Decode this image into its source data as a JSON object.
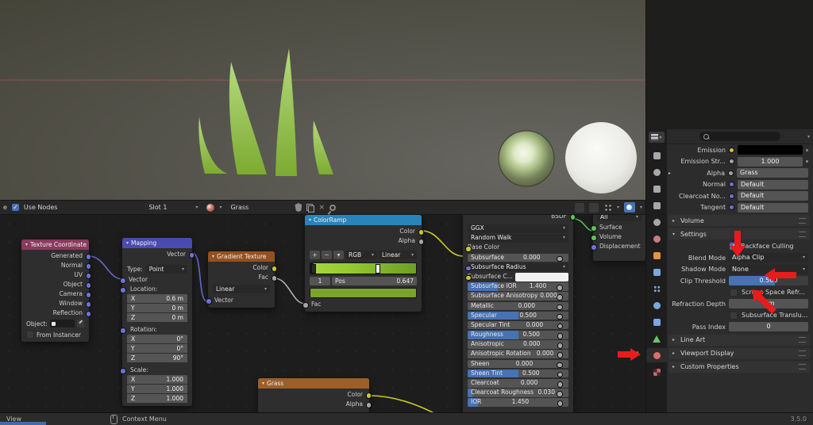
{
  "meta": {
    "version": "3.5.0"
  },
  "shader_header": {
    "left_fragment": "e",
    "use_nodes_label": "Use Nodes",
    "slot": "Slot 1",
    "material_name": "Grass"
  },
  "icons": {
    "close": "×",
    "search": "magnifier",
    "context_menu_mouse": "mouse"
  },
  "nodes": {
    "texture_coordinate": {
      "title": "Texture Coordinate",
      "outputs": [
        "Generated",
        "Normal",
        "UV",
        "Object",
        "Camera",
        "Window",
        "Reflection"
      ],
      "object_label": "Object:",
      "from_instancer_label": "From Instancer"
    },
    "mapping": {
      "title": "Mapping",
      "output": "Vector",
      "type_label": "Type:",
      "type_value": "Point",
      "vector_input": "Vector",
      "groups": [
        {
          "label": "Location:",
          "rows": [
            [
              "X",
              "0.6 m"
            ],
            [
              "Y",
              "0 m"
            ],
            [
              "Z",
              "0 m"
            ]
          ]
        },
        {
          "label": "Rotation:",
          "rows": [
            [
              "X",
              "0°"
            ],
            [
              "Y",
              "0°"
            ],
            [
              "Z",
              "90°"
            ]
          ]
        },
        {
          "label": "Scale:",
          "rows": [
            [
              "X",
              "1.000"
            ],
            [
              "Y",
              "1.000"
            ],
            [
              "Z",
              "1.000"
            ]
          ]
        }
      ]
    },
    "gradient_texture": {
      "title": "Gradient Texture",
      "outputs": [
        {
          "label": "Color",
          "socket": "yellow"
        },
        {
          "label": "Fac",
          "socket": "gray"
        }
      ],
      "mode": "Linear",
      "input": "Vector"
    },
    "color_ramp": {
      "title": "ColorRamp",
      "outputs": [
        {
          "label": "Color",
          "socket": "yellow"
        },
        {
          "label": "Alpha",
          "socket": "gray"
        }
      ],
      "add_label": "+",
      "remove_label": "−",
      "color_mode": "RGB",
      "interpolation": "Linear",
      "index": "1",
      "pos_label": "Pos",
      "pos_value": "0.647",
      "input": "Fac"
    },
    "principled_bsdf": {
      "output": "BSDF",
      "distribution": "GGX",
      "subsurface_method": "Random Walk",
      "rows": [
        {
          "label": "Base Color",
          "kind": "label",
          "socket": "yellow"
        },
        {
          "label": "Subsurface",
          "value": "0.000",
          "kind": "slider",
          "fill": 0,
          "socket": "gray"
        },
        {
          "label": "Subsurface Radius",
          "kind": "dropdown",
          "socket": "purple"
        },
        {
          "label": "Subsurface C...",
          "kind": "color",
          "socket": "yellow"
        },
        {
          "label": "Subsurface IOR",
          "value": "1.400",
          "kind": "slider",
          "fill": 0.3,
          "socket": "gray"
        },
        {
          "label": "Subsurface Anisotropy",
          "value": "0.000",
          "kind": "slider",
          "fill": 0,
          "socket": "gray"
        },
        {
          "label": "Metallic",
          "value": "0.000",
          "kind": "slider",
          "fill": 0,
          "socket": "gray"
        },
        {
          "label": "Specular",
          "value": "0.500",
          "kind": "slider",
          "fill": 0.5,
          "socket": "gray"
        },
        {
          "label": "Specular Tint",
          "value": "0.000",
          "kind": "slider",
          "fill": 0,
          "socket": "gray"
        },
        {
          "label": "Roughness",
          "value": "0.500",
          "kind": "slider",
          "fill": 0.5,
          "socket": "gray"
        },
        {
          "label": "Anisotropic",
          "value": "0.000",
          "kind": "slider",
          "fill": 0,
          "socket": "gray"
        },
        {
          "label": "Anisotropic Rotation",
          "value": "0.000",
          "kind": "slider",
          "fill": 0,
          "socket": "gray"
        },
        {
          "label": "Sheen",
          "value": "0.000",
          "kind": "slider",
          "fill": 0,
          "socket": "gray"
        },
        {
          "label": "Sheen Tint",
          "value": "0.500",
          "kind": "slider",
          "fill": 0.5,
          "socket": "gray"
        },
        {
          "label": "Clearcoat",
          "value": "0.000",
          "kind": "slider",
          "fill": 0,
          "socket": "gray"
        },
        {
          "label": "Clearcoat Roughness",
          "value": "0.030",
          "kind": "slider",
          "fill": 0.05,
          "socket": "gray"
        },
        {
          "label": "IOR",
          "value": "1.450",
          "kind": "slider",
          "fill": 0.1,
          "socket": "gray"
        }
      ]
    },
    "material_output": {
      "target": "All",
      "inputs": [
        {
          "label": "Surface",
          "socket": "green"
        },
        {
          "label": "Volume",
          "socket": "green"
        },
        {
          "label": "Displacement",
          "socket": "purple"
        }
      ]
    },
    "grass_group": {
      "title": "Grass",
      "outputs": [
        {
          "label": "Color",
          "socket": "yellow"
        },
        {
          "label": "Alpha",
          "socket": "gray"
        }
      ]
    }
  },
  "properties": {
    "tabs": [
      {
        "name": "tab-tool",
        "color": "#a8a8a8",
        "shape": "square"
      },
      {
        "name": "tab-render",
        "color": "#a8a8a8",
        "shape": "circle"
      },
      {
        "name": "tab-output",
        "color": "#a8a8a8",
        "shape": "square"
      },
      {
        "name": "tab-view-layer",
        "color": "#a8a8a8",
        "shape": "square"
      },
      {
        "name": "tab-scene",
        "color": "#a8a8a8",
        "shape": "circle"
      },
      {
        "name": "tab-world",
        "color": "#c77d7d",
        "shape": "circle"
      },
      {
        "name": "tab-object",
        "color": "#e8913f",
        "shape": "square"
      },
      {
        "name": "tab-modifiers",
        "color": "#7ba7e0",
        "shape": "square"
      },
      {
        "name": "tab-particles",
        "color": "#7ba7e0",
        "shape": "dots"
      },
      {
        "name": "tab-physics",
        "color": "#7ba7e0",
        "shape": "circle"
      },
      {
        "name": "tab-constraints",
        "color": "#7ba7e0",
        "shape": "square"
      },
      {
        "name": "tab-object-data",
        "color": "#6fbf6f",
        "shape": "tri"
      },
      {
        "name": "tab-material",
        "color": "#e06c6c",
        "shape": "circle",
        "active": true
      },
      {
        "name": "tab-texture",
        "color": "#c66a6a",
        "shape": "checker"
      }
    ],
    "surface_rows": [
      {
        "label": "Emission",
        "kind": "colorbar",
        "socket": "yellow"
      },
      {
        "label": "Emission Str...",
        "kind": "value",
        "value": "1.000",
        "socket": "gray"
      },
      {
        "label": "Alpha",
        "kind": "field",
        "value": "Grass",
        "socket": "gray",
        "expander": true
      },
      {
        "label": "Normal",
        "kind": "field",
        "value": "Default",
        "socket": "purple"
      },
      {
        "label": "Clearcoat No...",
        "kind": "field",
        "value": "Default",
        "socket": "purple"
      },
      {
        "label": "Tangent",
        "kind": "field",
        "value": "Default",
        "socket": "purple"
      }
    ],
    "volume_panel": "Volume",
    "settings_panel": "Settings",
    "settings": {
      "backface": {
        "label": "Backface Culling",
        "checked": true
      },
      "blend_mode": {
        "label": "Blend Mode",
        "value": "Alpha Clip"
      },
      "shadow_mode": {
        "label": "Shadow Mode",
        "value": "None"
      },
      "clip_threshold": {
        "label": "Clip Threshold",
        "value": "0.500"
      },
      "screen_space": {
        "label": "Screen Space Refr...",
        "checked": false
      },
      "refraction_depth": {
        "label": "Refraction Depth",
        "value": "0 m"
      },
      "subsurface_trans": {
        "label": "Subsurface Translu...",
        "checked": false
      },
      "pass_index": {
        "label": "Pass Index",
        "value": "0"
      }
    },
    "bottom_panels": [
      "Line Art",
      "Viewport Display",
      "Custom Properties"
    ]
  },
  "status_bar": {
    "left": "View",
    "context_menu": "Context Menu"
  }
}
